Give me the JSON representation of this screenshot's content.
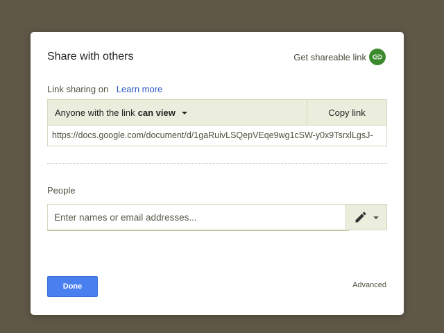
{
  "dialog": {
    "title": "Share with others",
    "get_link_label": "Get shareable link",
    "link_icon": "link-icon",
    "accent_color": "#3c8a2e"
  },
  "link_sharing": {
    "status": "Link sharing on",
    "learn_more": "Learn more",
    "access_prefix": "Anyone with the link",
    "access_level": "can view",
    "copy_label": "Copy link",
    "url": "https://docs.google.com/document/d/1gaRuivLSQepVEqe9wg1cSW-y0x9TsrxlLgsJ-"
  },
  "people": {
    "label": "People",
    "placeholder": "Enter names or email addresses...",
    "permission_icon": "pencil-icon"
  },
  "footer": {
    "done_label": "Done",
    "done_color": "#4a7fef",
    "advanced_label": "Advanced"
  }
}
